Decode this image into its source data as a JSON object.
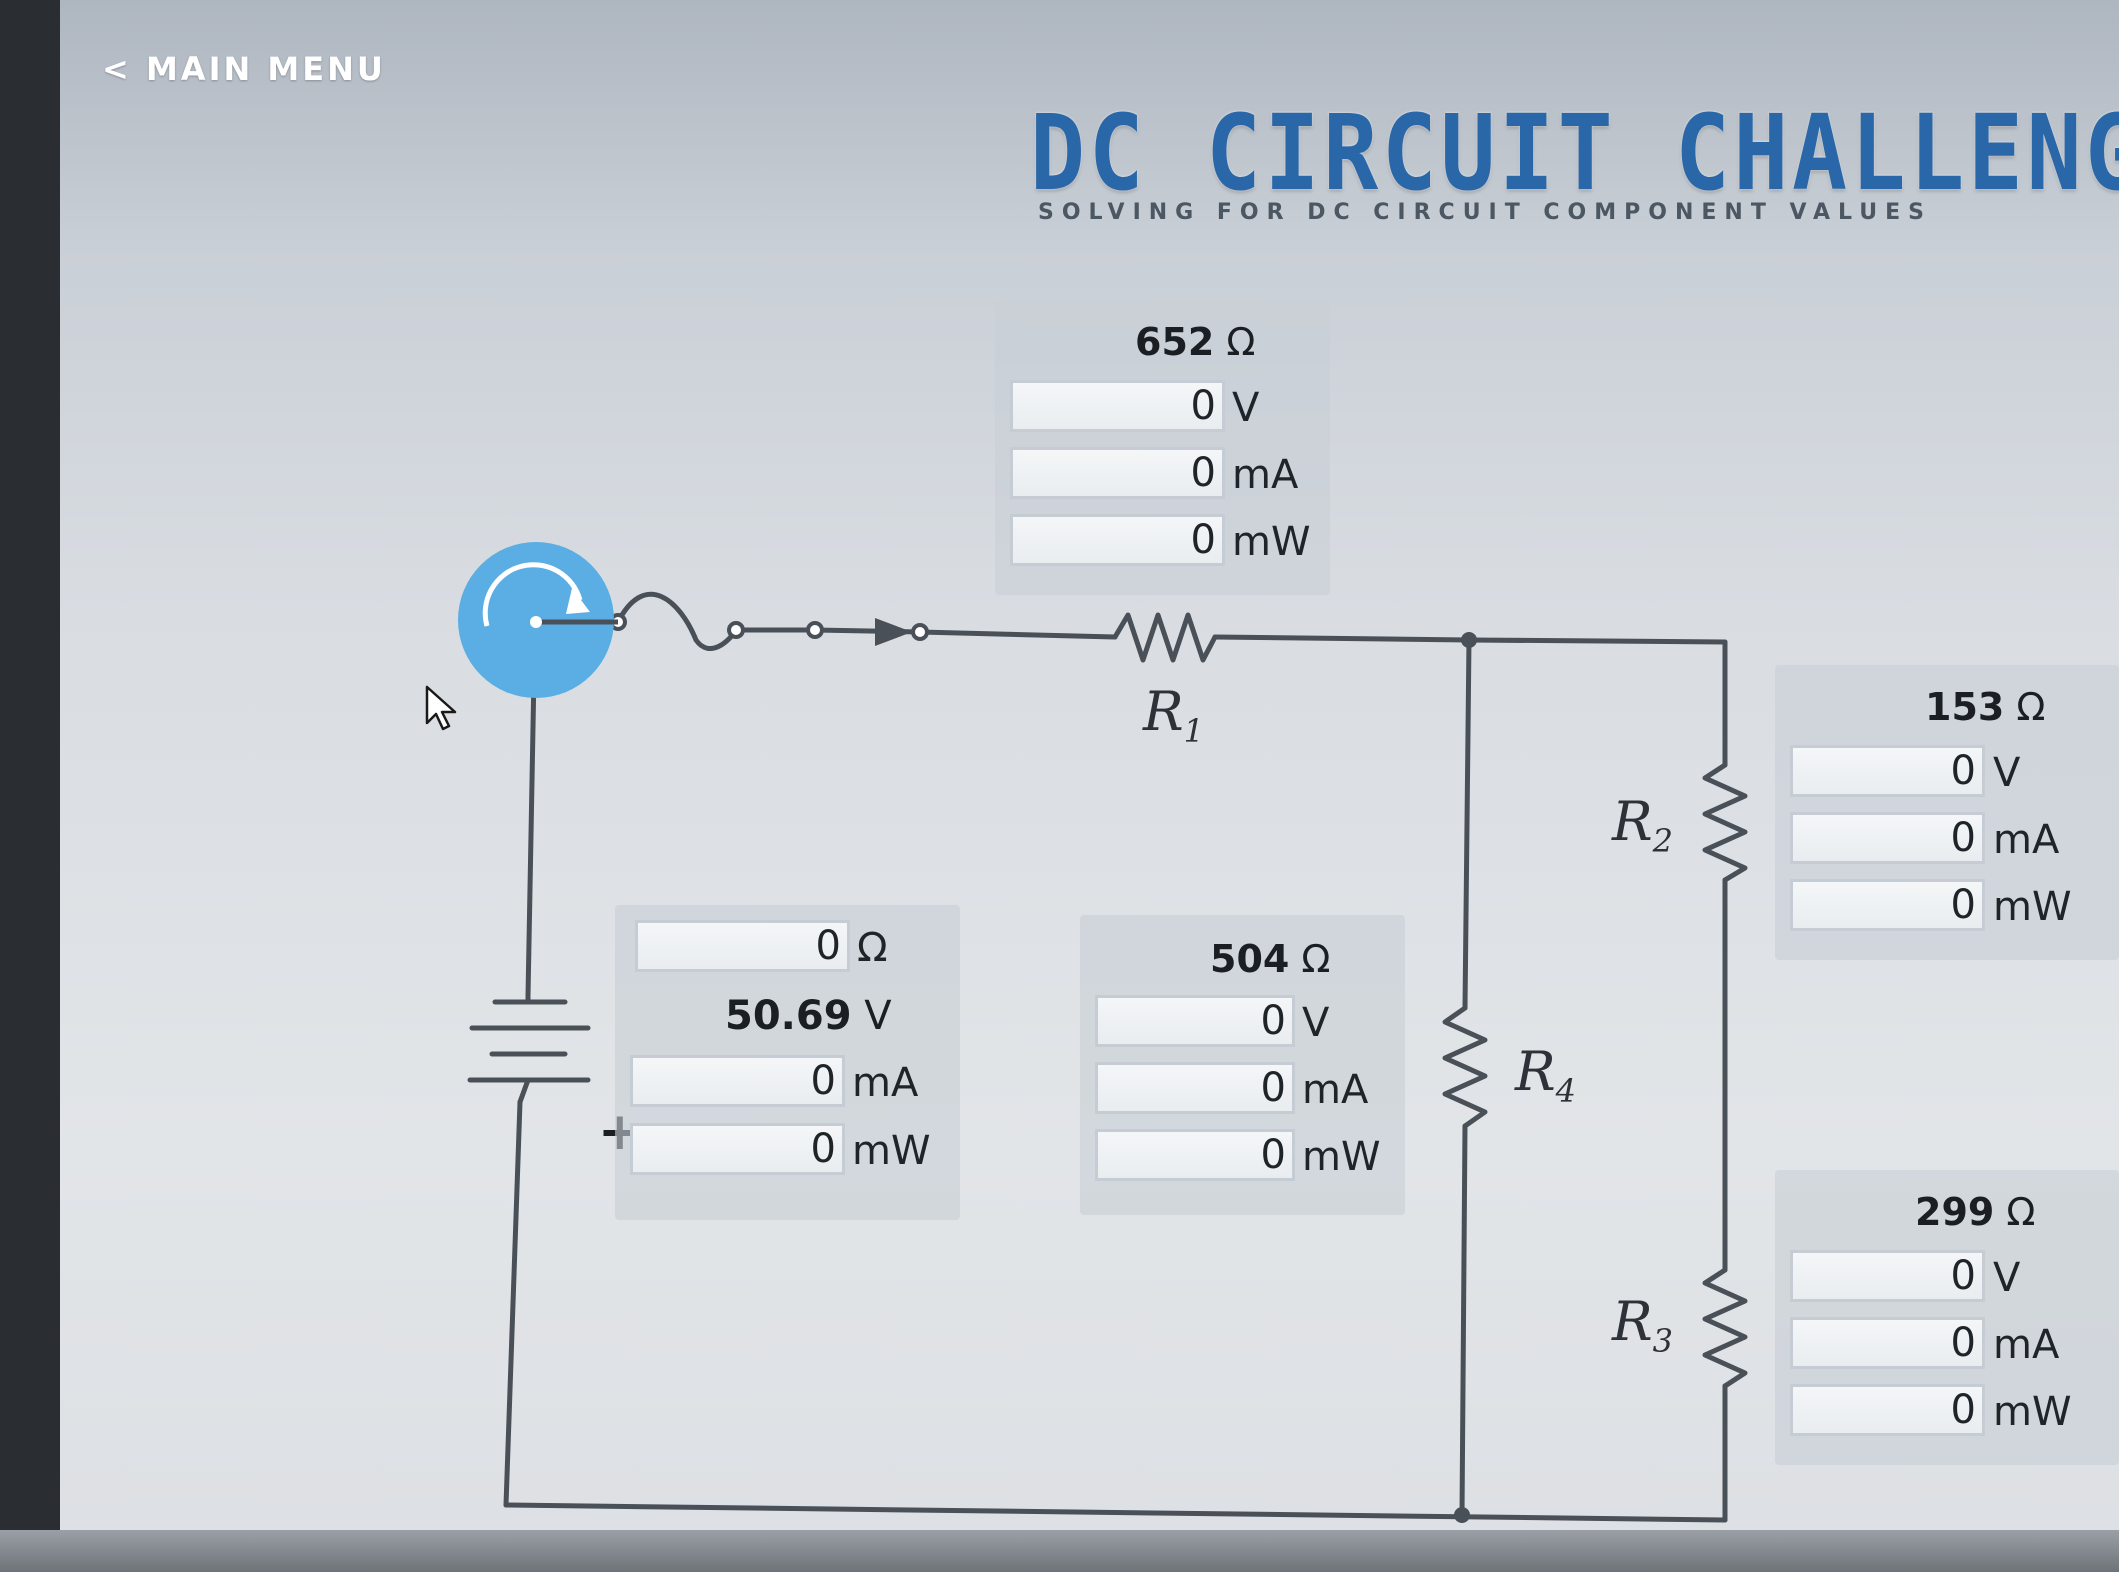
{
  "nav": {
    "main_menu_label": "< MAIN MENU"
  },
  "header": {
    "title": "DC CIRCUIT CHALLENGE",
    "subtitle": "SOLVING FOR DC CIRCUIT COMPONENT VALUES"
  },
  "colors": {
    "title_blue": "#2a67a8",
    "knob_blue": "#5aaee3",
    "wire": "#4a5058"
  },
  "icons": {
    "knob": "rotate-knob-icon",
    "cursor": "mouse-pointer-icon",
    "battery": "battery-icon",
    "switch": "switch-icon"
  },
  "resistors": {
    "r1": {
      "label": "R",
      "sub": "1",
      "ohms": "652",
      "unit_ohm": "Ω",
      "voltage": "0",
      "current": "0",
      "power": "0"
    },
    "r2": {
      "label": "R",
      "sub": "2",
      "ohms": "153",
      "unit_ohm": "Ω",
      "voltage": "0",
      "current": "0",
      "power": "0"
    },
    "r3": {
      "label": "R",
      "sub": "3",
      "ohms": "299",
      "unit_ohm": "Ω",
      "voltage": "0",
      "current": "0",
      "power": "0"
    },
    "r4": {
      "label": "R",
      "sub": "4",
      "ohms": "504",
      "unit_ohm": "Ω",
      "voltage": "0",
      "current": "0",
      "power": "0"
    }
  },
  "source": {
    "resistance": "0",
    "unit_ohm": "Ω",
    "voltage": "50.69",
    "unit_v": "V",
    "current": "0",
    "power": "0",
    "plus_sign": "+"
  },
  "units": {
    "v": "V",
    "ma": "mA",
    "mw": "mW"
  }
}
